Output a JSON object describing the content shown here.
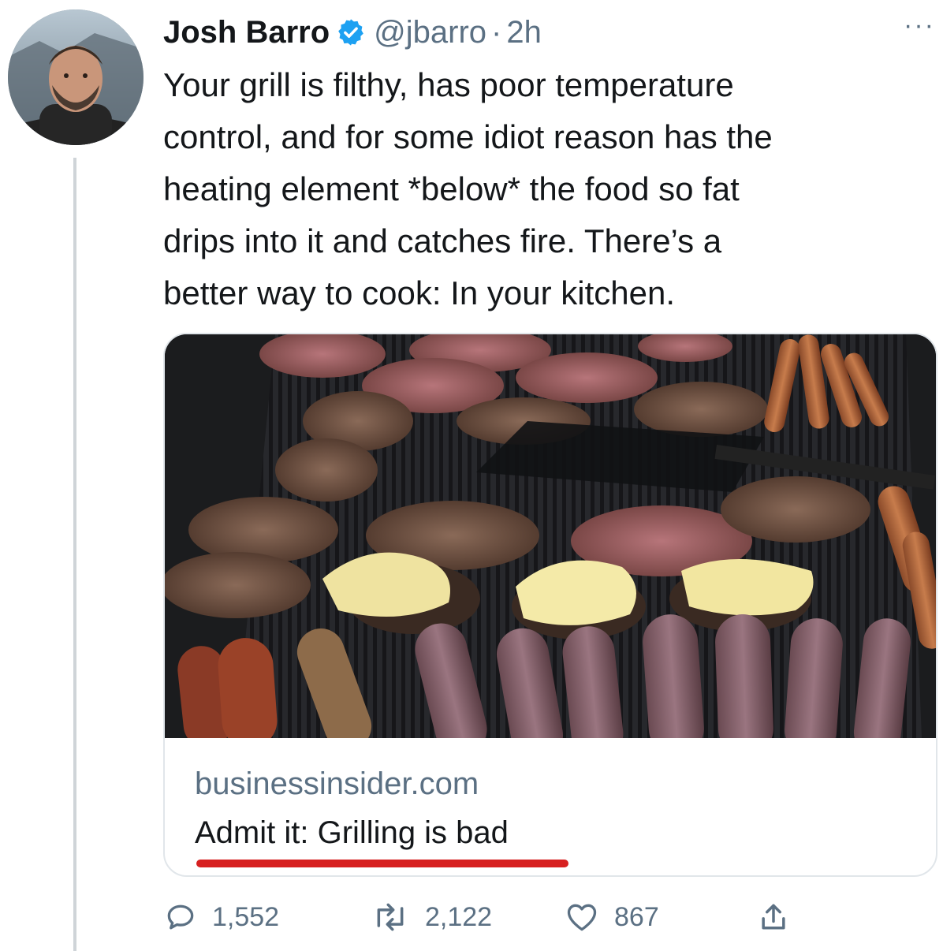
{
  "tweet": {
    "author_name": "Josh Barro",
    "handle": "@jbarro",
    "separator": "·",
    "time": "2h",
    "more": "···",
    "text": "Your grill is filthy, has poor temperature\ncontrol, and for some idiot reason has the\nheating element *below* the food so fat\ndrips into it and catches fire. There’s a\nbetter way to cook: In your kitchen."
  },
  "card": {
    "domain": "businessinsider.com",
    "title": "Admit it: Grilling is bad",
    "image_description_icon": "grill-photo"
  },
  "actions": {
    "replies": "1,552",
    "retweets": "2,122",
    "likes": "867"
  },
  "colors": {
    "verified": "#1da1f2",
    "secondary_text": "#5b7083",
    "underline": "#d72020"
  }
}
